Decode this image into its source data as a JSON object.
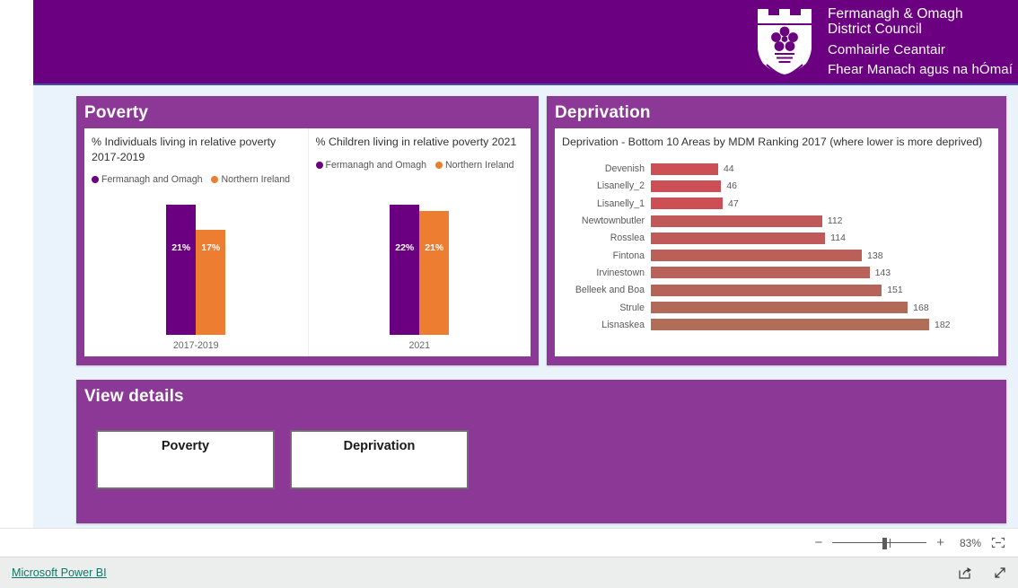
{
  "header": {
    "logo_icon": "fermanagh-omagh-crest-icon",
    "english_line1": "Fermanagh & Omagh",
    "english_line2": "District Council",
    "irish_line1": "Comhairle Ceantair",
    "irish_line2": "Fhear Manach agus na hÓmaí",
    "background_color": "#6b0080"
  },
  "cards": {
    "poverty": {
      "title": "Poverty",
      "accent_color": "#8c3896"
    },
    "deprivation": {
      "title": "Deprivation",
      "accent_color": "#8c3896"
    },
    "view_details": {
      "title": "View details",
      "buttons": [
        {
          "label": "Poverty"
        },
        {
          "label": "Deprivation"
        }
      ]
    }
  },
  "chart_data": [
    {
      "type": "bar",
      "title": "% Individuals living in relative poverty 2017-2019",
      "xlabel": "",
      "ylabel": "",
      "categories": [
        "2017-2019"
      ],
      "ylim": [
        0,
        24
      ],
      "grid": false,
      "legend_position": "top-left",
      "series": [
        {
          "name": "Fermanagh and Omagh",
          "color": "#6b0080",
          "values": [
            21
          ],
          "labels": [
            "21%"
          ]
        },
        {
          "name": "Northern Ireland",
          "color": "#ed7d31",
          "values": [
            17
          ],
          "labels": [
            "17%"
          ]
        }
      ]
    },
    {
      "type": "bar",
      "title": "% Children living in relative poverty 2021",
      "xlabel": "",
      "ylabel": "",
      "categories": [
        "2021"
      ],
      "ylim": [
        0,
        24
      ],
      "grid": false,
      "legend_position": "top-left",
      "series": [
        {
          "name": "Fermanagh and Omagh",
          "color": "#6b0080",
          "values": [
            22
          ],
          "labels": [
            "22%"
          ]
        },
        {
          "name": "Northern Ireland",
          "color": "#ed7d31",
          "values": [
            21
          ],
          "labels": [
            "21%"
          ]
        }
      ]
    },
    {
      "type": "bar",
      "orientation": "horizontal",
      "title": "Deprivation - Bottom 10 Areas by MDM Ranking 2017 (where lower is more deprived)",
      "xlabel": "",
      "ylabel": "",
      "grid": false,
      "xlim": [
        0,
        182
      ],
      "categories": [
        "Devenish",
        "Lisanelly_2",
        "Lisanelly_1",
        "Newtownbutler",
        "Rosslea",
        "Fintona",
        "Irvinestown",
        "Belleek and Boa",
        "Strule",
        "Lisnaskea"
      ],
      "values": [
        44,
        46,
        47,
        112,
        114,
        138,
        143,
        151,
        168,
        182
      ],
      "bar_colors": [
        "#cc4f55",
        "#cc4f55",
        "#cc4f55",
        "#c1595a",
        "#c0595a",
        "#bb6059",
        "#b96259",
        "#b66458",
        "#b26957",
        "#b06d57"
      ]
    }
  ],
  "zoom_bar": {
    "minus_label": "−",
    "plus_label": "+",
    "percent": "83%",
    "fit_icon": "fit-to-page-icon"
  },
  "footer": {
    "link_label": "Microsoft Power BI",
    "share_icon": "share-icon",
    "fullscreen_icon": "fullscreen-icon"
  }
}
